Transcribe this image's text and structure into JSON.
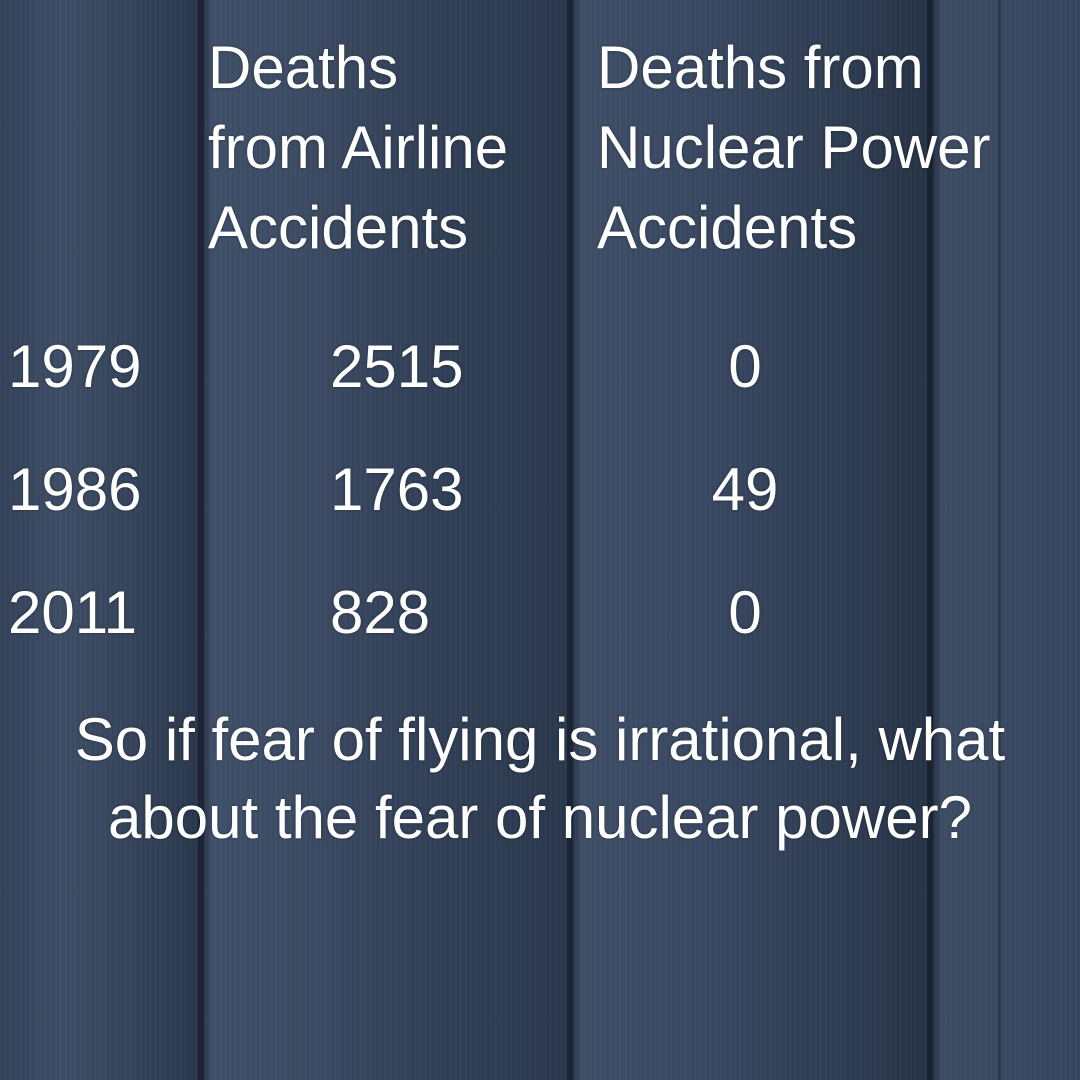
{
  "table": {
    "headers": {
      "airline": "Deaths\nfrom Airline\nAccidents",
      "nuclear": "Deaths from\nNuclear Power\nAccidents"
    },
    "rows": [
      {
        "year": "1979",
        "airline": "2515",
        "nuclear": "0"
      },
      {
        "year": "1986",
        "airline": "1763",
        "nuclear": "49"
      },
      {
        "year": "2011",
        "airline": "828",
        "nuclear": "0"
      }
    ]
  },
  "footer": {
    "text": "So if fear of flying is irrational, what about the fear of nuclear power?"
  },
  "colors": {
    "text": "#ffffff",
    "background": "#3b4a60"
  }
}
